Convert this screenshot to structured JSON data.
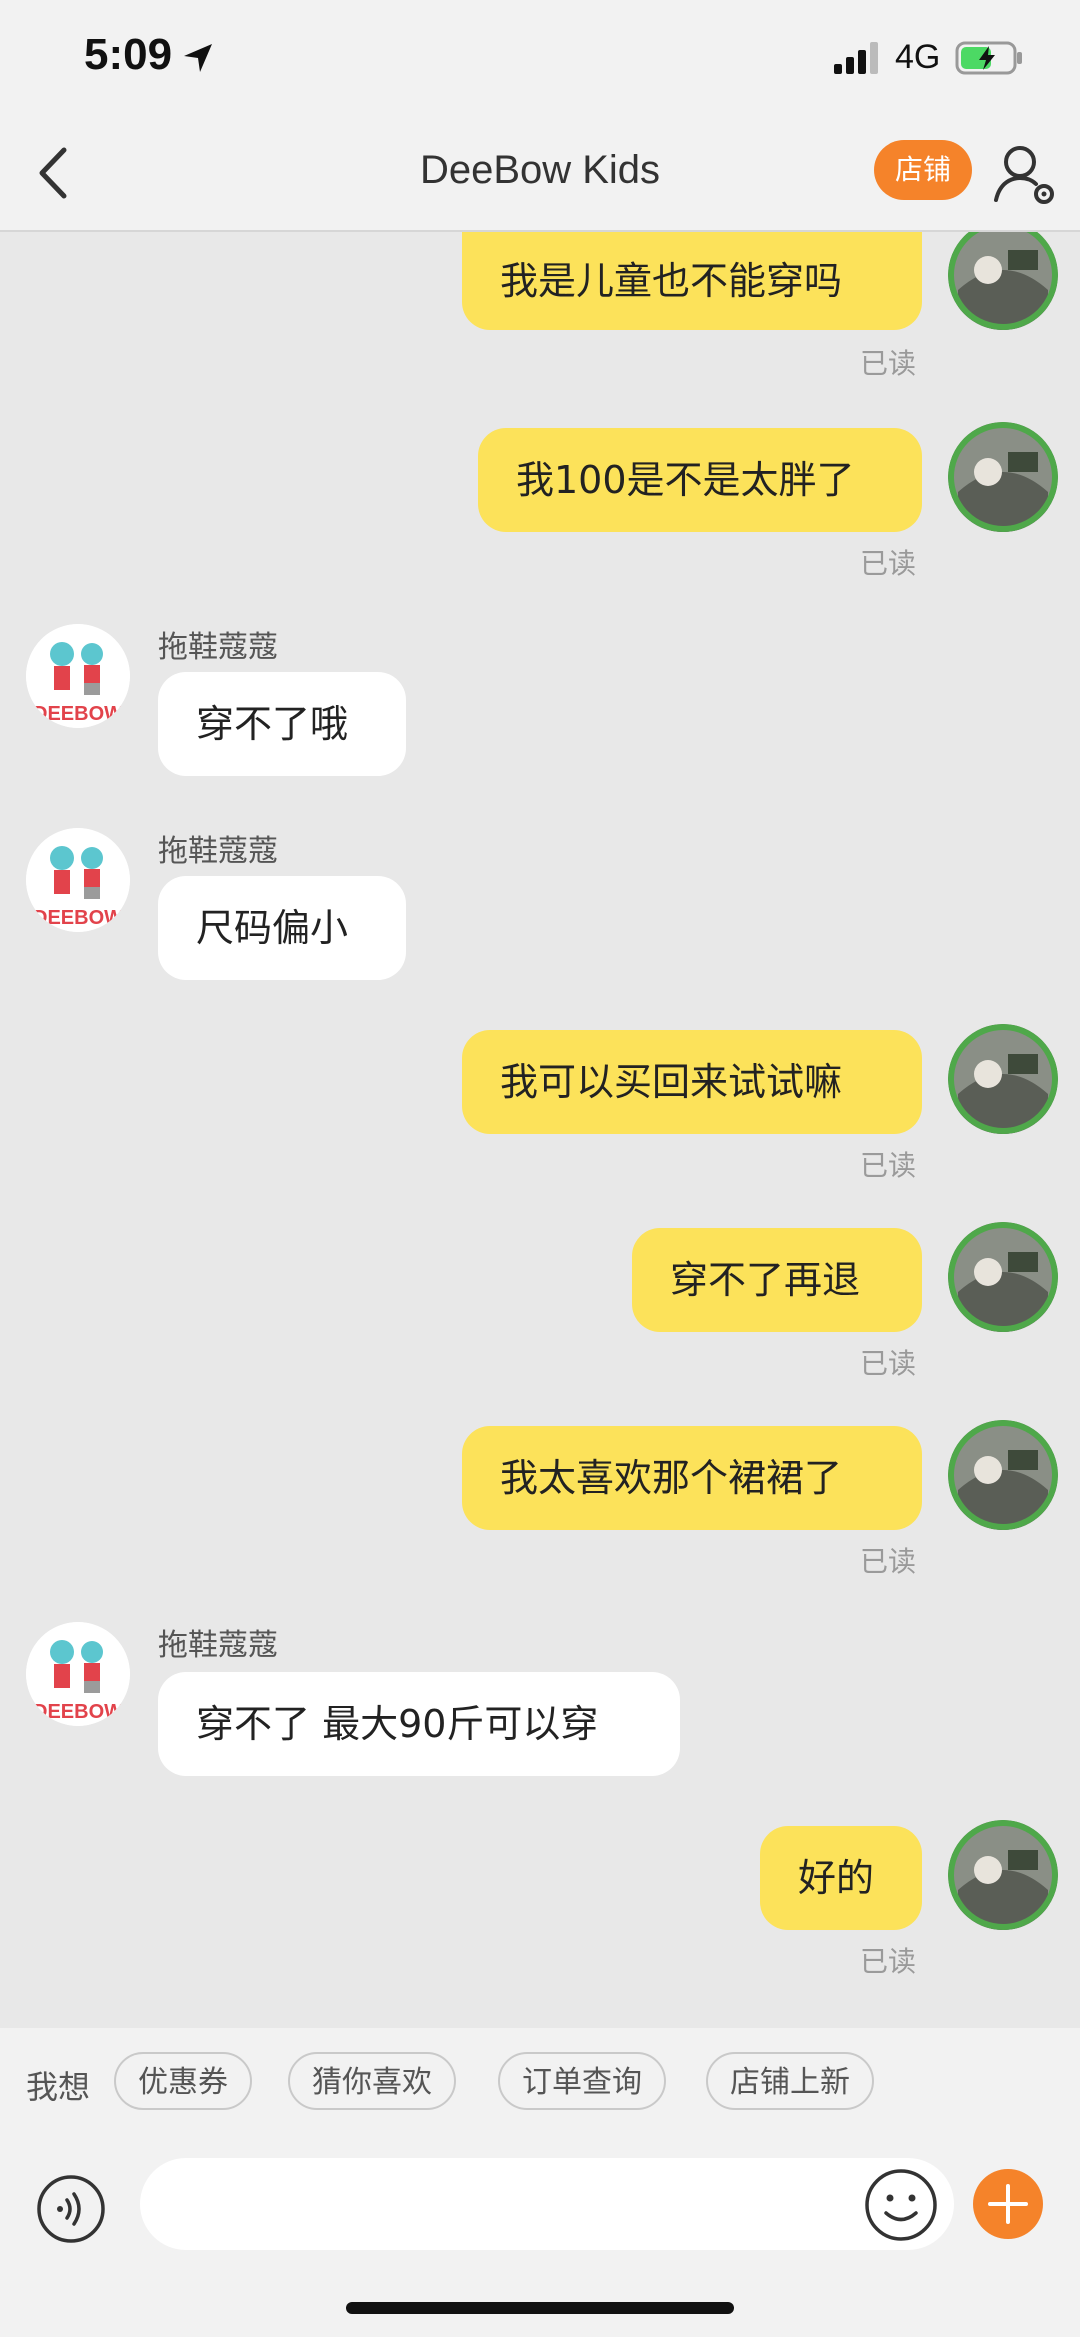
{
  "status_bar": {
    "time": "5:09",
    "network": "4G",
    "icons": [
      "location-arrow-icon",
      "signal-icon",
      "battery-charging-icon"
    ]
  },
  "nav": {
    "title": "DeeBow Kids",
    "shop_button": "店铺",
    "icons": [
      "back-chevron-icon",
      "profile-settings-icon"
    ]
  },
  "shop": {
    "logo_text": "DEEBOW",
    "sender_name": "拖鞋蔻蔻"
  },
  "colors": {
    "outgoing_bubble": "#fce25a",
    "incoming_bubble": "#ffffff",
    "accent": "#f5832a",
    "background": "#e8e8e8"
  },
  "messages": [
    {
      "direction": "out",
      "text": "我是儿童也不能穿吗",
      "status": "已读"
    },
    {
      "direction": "out",
      "text": "我100是不是太胖了",
      "status": "已读"
    },
    {
      "direction": "in",
      "sender": "拖鞋蔻蔻",
      "text": "穿不了哦"
    },
    {
      "direction": "in",
      "sender": "拖鞋蔻蔻",
      "text": "尺码偏小"
    },
    {
      "direction": "out",
      "text": "我可以买回来试试嘛",
      "status": "已读"
    },
    {
      "direction": "out",
      "text": "穿不了再退",
      "status": "已读"
    },
    {
      "direction": "out",
      "text": "我太喜欢那个裙裙了",
      "status": "已读"
    },
    {
      "direction": "in",
      "sender": "拖鞋蔻蔻",
      "text": "穿不了 最大90斤可以穿"
    },
    {
      "direction": "out",
      "text": "好的",
      "status": "已读"
    }
  ],
  "quick_replies": {
    "label": "我想",
    "chips": [
      "优惠券",
      "猜你喜欢",
      "订单查询",
      "店铺上新"
    ]
  },
  "input": {
    "placeholder": "",
    "value": "",
    "icons": [
      "voice-icon",
      "emoji-icon",
      "plus-icon"
    ]
  }
}
